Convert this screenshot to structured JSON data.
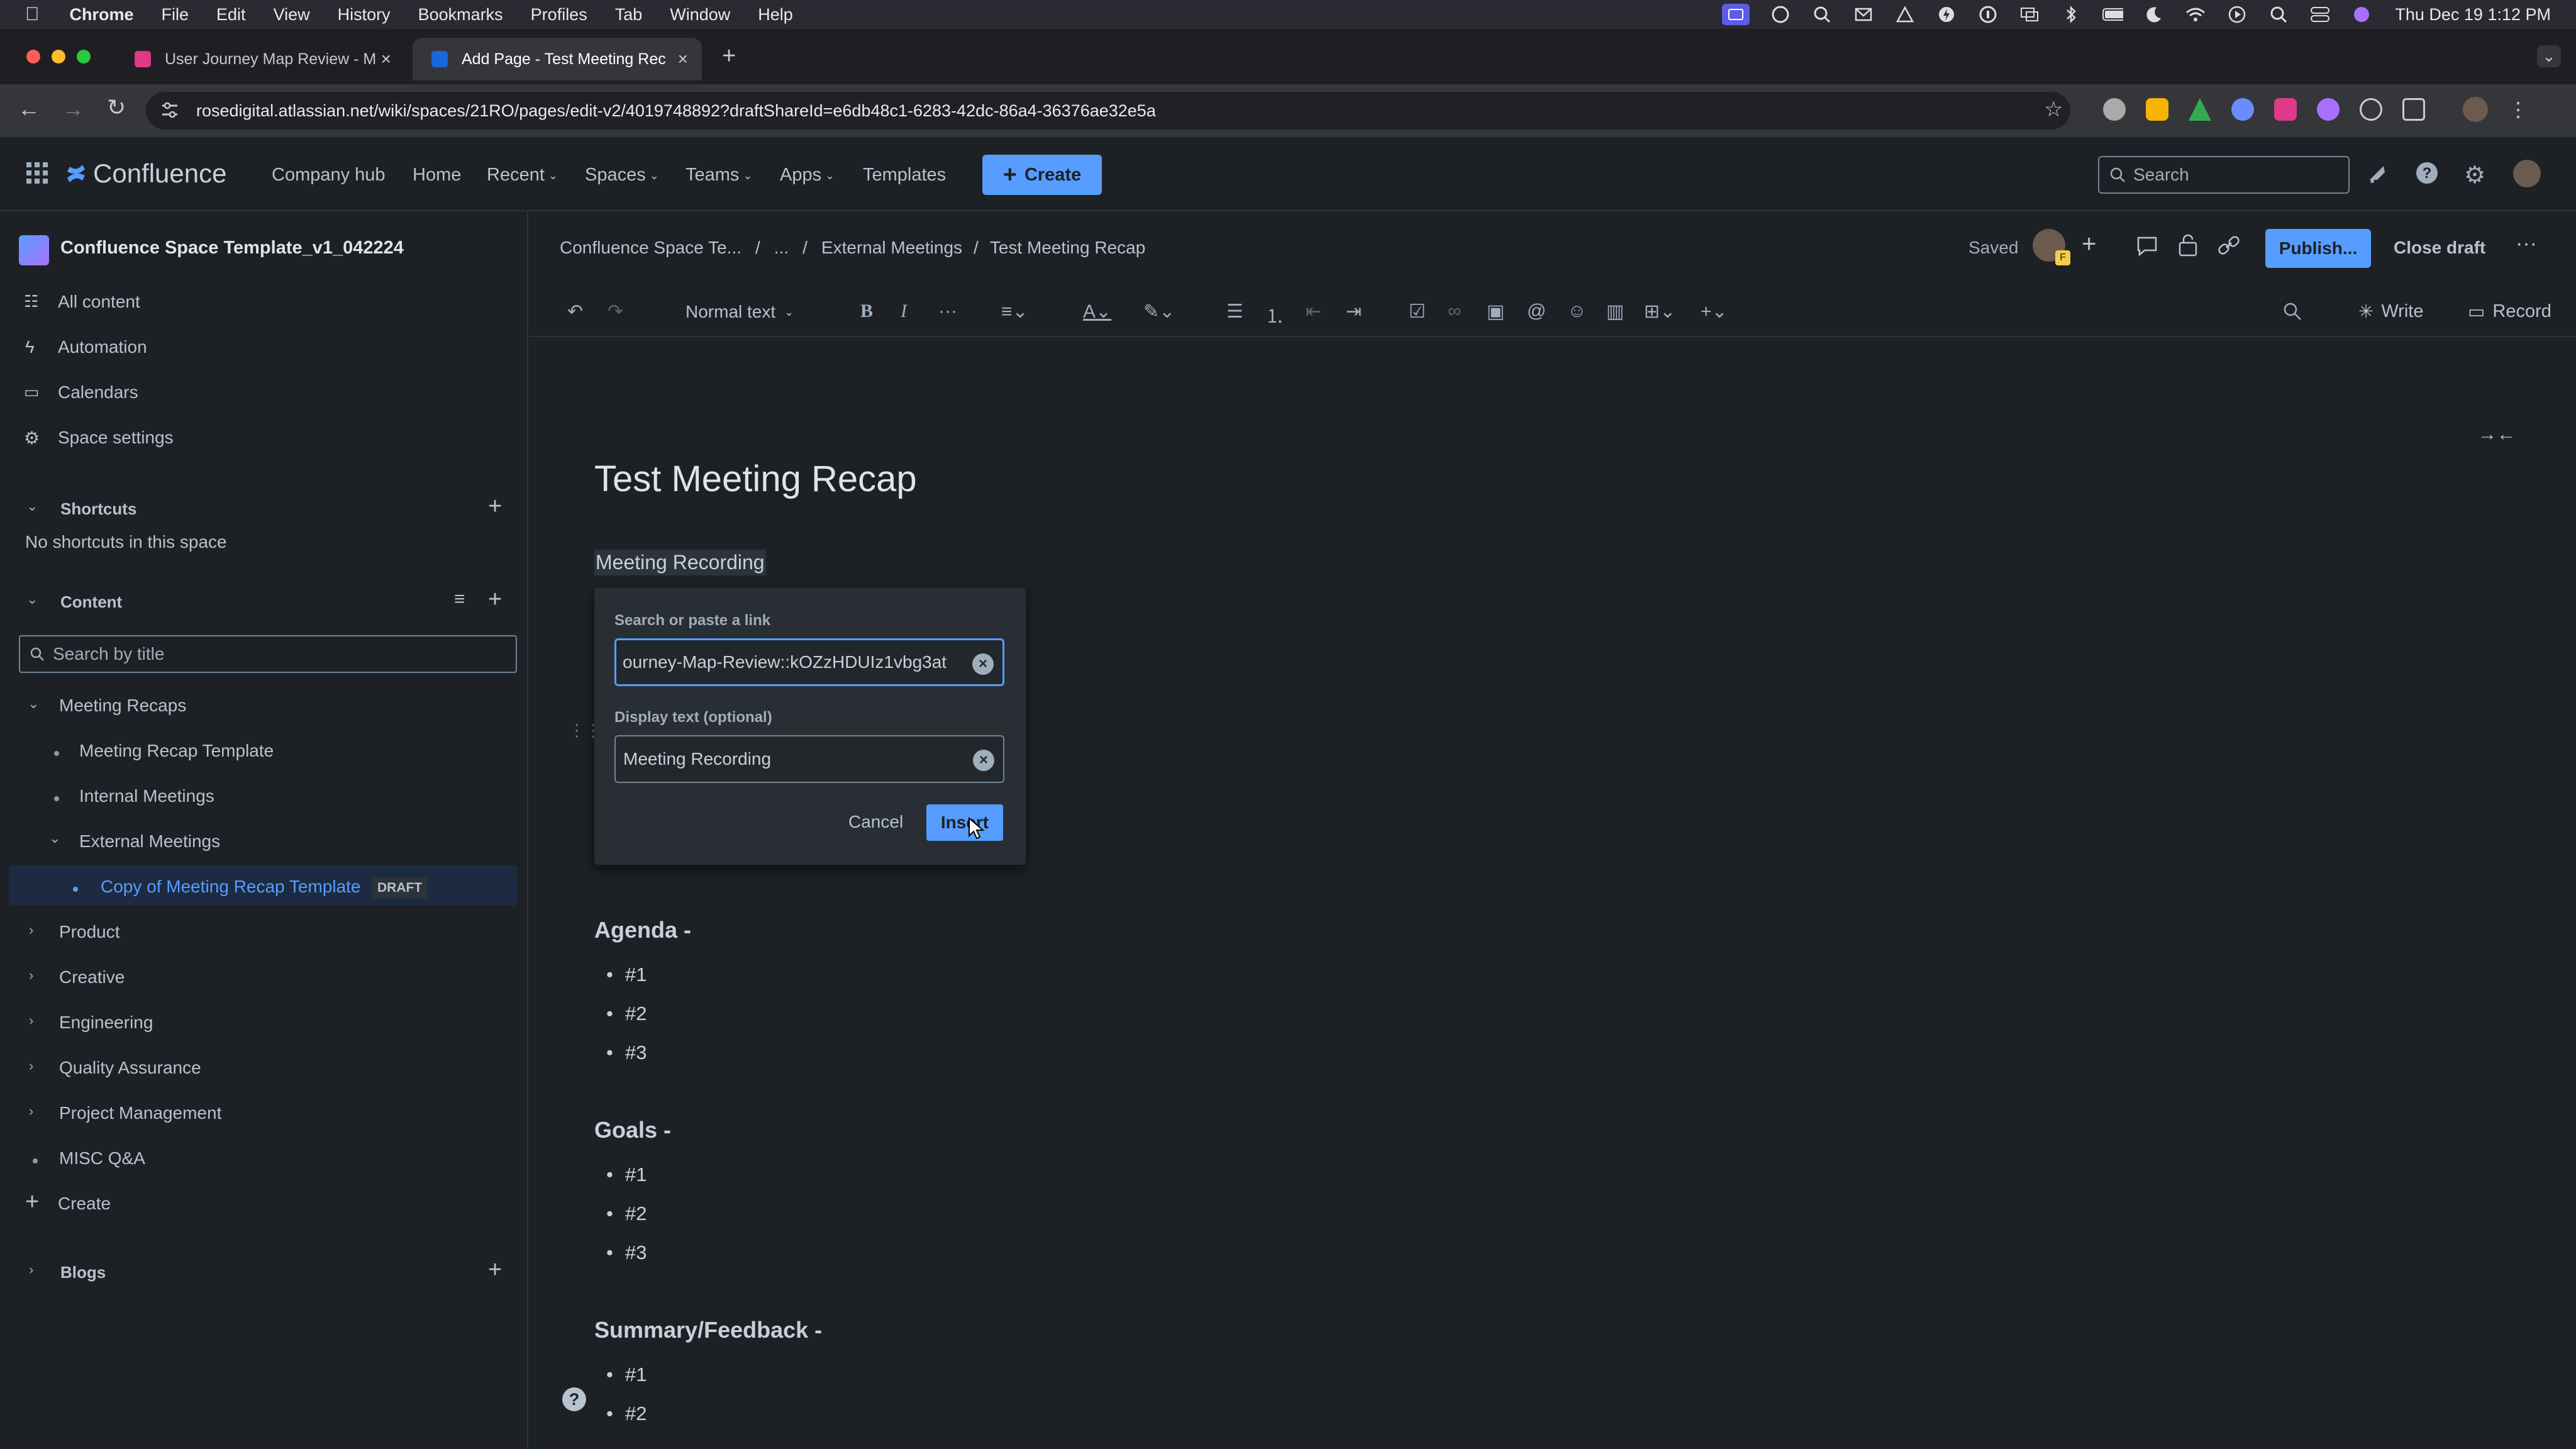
{
  "menubar": {
    "app": "Chrome",
    "items": [
      "File",
      "Edit",
      "View",
      "History",
      "Bookmarks",
      "Profiles",
      "Tab",
      "Window",
      "Help"
    ],
    "clock": "Thu Dec 19  1:12 PM"
  },
  "browser": {
    "tabs": [
      {
        "title": "User Journey Map Review - M",
        "active": false
      },
      {
        "title": "Add Page - Test Meeting Rec",
        "active": true
      }
    ],
    "url": "rosedigital.atlassian.net/wiki/spaces/21RO/pages/edit-v2/4019748892?draftShareId=e6db48c1-6283-42dc-86a4-36376ae32e5a"
  },
  "topnav": {
    "logo": "Confluence",
    "items": [
      {
        "label": "Company hub",
        "dropdown": false
      },
      {
        "label": "Home",
        "dropdown": false
      },
      {
        "label": "Recent",
        "dropdown": true
      },
      {
        "label": "Spaces",
        "dropdown": true
      },
      {
        "label": "Teams",
        "dropdown": true
      },
      {
        "label": "Apps",
        "dropdown": true
      },
      {
        "label": "Templates",
        "dropdown": false
      }
    ],
    "create_label": "Create",
    "search_placeholder": "Search"
  },
  "sidebar": {
    "space_name": "Confluence Space Template_v1_042224",
    "menu": [
      "All content",
      "Automation",
      "Calendars",
      "Space settings"
    ],
    "shortcuts_title": "Shortcuts",
    "shortcuts_empty": "No shortcuts in this space",
    "content_title": "Content",
    "search_placeholder": "Search by title",
    "tree": {
      "meeting_recaps": "Meeting Recaps",
      "meeting_recap_template": "Meeting Recap Template",
      "internal_meetings": "Internal Meetings",
      "external_meetings": "External Meetings",
      "copy_of_template": "Copy of Meeting Recap Template",
      "draft_badge": "DRAFT",
      "product": "Product",
      "creative": "Creative",
      "engineering": "Engineering",
      "qa": "Quality Assurance",
      "pm": "Project Management",
      "misc": "MISC Q&A",
      "create": "Create"
    },
    "blogs_title": "Blogs"
  },
  "editor_header": {
    "breadcrumb": [
      "Confluence Space Te...",
      "...",
      "External Meetings",
      "Test Meeting Recap"
    ],
    "saved": "Saved",
    "publish": "Publish...",
    "close_draft": "Close draft",
    "text_style": "Normal text",
    "write": "Write",
    "record": "Record"
  },
  "document": {
    "title": "Test Meeting Recap",
    "link_text": "Meeting Recording",
    "agenda": {
      "heading": "Agenda -",
      "items": [
        "#1",
        "#2",
        "#3"
      ]
    },
    "goals": {
      "heading": "Goals -",
      "items": [
        "#1",
        "#2",
        "#3"
      ]
    },
    "summary": {
      "heading": "Summary/Feedback -",
      "items": [
        "#1",
        "#2"
      ]
    }
  },
  "link_dialog": {
    "search_label": "Search or paste a link",
    "search_value": "ourney-Map-Review::kOZzHDUIz1vbg3at",
    "display_label": "Display text (optional)",
    "display_value": "Meeting Recording",
    "cancel": "Cancel",
    "insert": "Insert"
  },
  "colors": {
    "accent": "#579dff",
    "background": "#1d2125",
    "dialog": "#282e33",
    "selected": "#1c2b41"
  }
}
